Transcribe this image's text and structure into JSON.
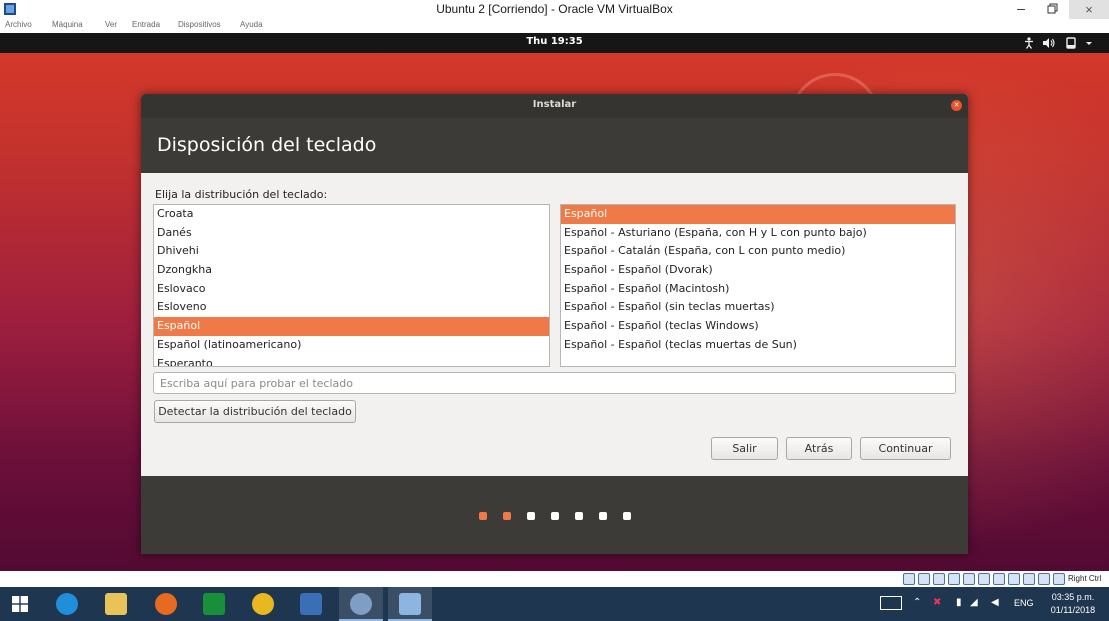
{
  "host_window": {
    "title": "Ubuntu 2 [Corriendo] - Oracle VM VirtualBox",
    "controls": {
      "minimize": "–",
      "close": "×"
    },
    "menu": [
      "Archivo",
      "Máquina",
      "Ver",
      "Entrada",
      "Dispositivos",
      "Ayuda"
    ]
  },
  "guest_topbar": {
    "clock": "Thu 19:35"
  },
  "installer": {
    "window_title": "Instalar",
    "heading": "Disposición del teclado",
    "prompt": "Elija la distribución del teclado:",
    "layouts": [
      {
        "label": "Croata",
        "selected": false
      },
      {
        "label": "Danés",
        "selected": false
      },
      {
        "label": "Dhivehi",
        "selected": false
      },
      {
        "label": "Dzongkha",
        "selected": false
      },
      {
        "label": "Eslovaco",
        "selected": false
      },
      {
        "label": "Esloveno",
        "selected": false
      },
      {
        "label": "Español",
        "selected": true
      },
      {
        "label": "Español (latinoamericano)",
        "selected": false
      },
      {
        "label": "Esperanto",
        "selected": false
      }
    ],
    "variants": [
      {
        "label": "Español",
        "selected": true
      },
      {
        "label": "Español - Asturiano (España, con H y L con punto bajo)",
        "selected": false
      },
      {
        "label": "Español - Catalán (España, con L con punto medio)",
        "selected": false
      },
      {
        "label": "Español - Español (Dvorak)",
        "selected": false
      },
      {
        "label": "Español - Español (Macintosh)",
        "selected": false
      },
      {
        "label": "Español - Español (sin teclas muertas)",
        "selected": false
      },
      {
        "label": "Español - Español (teclas Windows)",
        "selected": false
      },
      {
        "label": "Español - Español (teclas muertas de Sun)",
        "selected": false
      }
    ],
    "test_input": {
      "value": "",
      "placeholder": "Escriba aquí para probar el teclado"
    },
    "detect_button": "Detectar la distribución del teclado",
    "nav_buttons": {
      "quit": "Salir",
      "back": "Atrás",
      "continue": "Continuar"
    },
    "progress": {
      "total_steps": 7,
      "completed_steps": 2
    }
  },
  "host_statusbar": {
    "host_key": "Right Ctrl"
  },
  "taskbar": {
    "language": "ENG",
    "time": "03:35 p.m.",
    "date": "01/11/2018"
  },
  "colors": {
    "accent_orange": "#ef7a48",
    "installer_header": "#3c3b37",
    "installer_titlebar": "#363431",
    "taskbar": "#1f3650"
  }
}
